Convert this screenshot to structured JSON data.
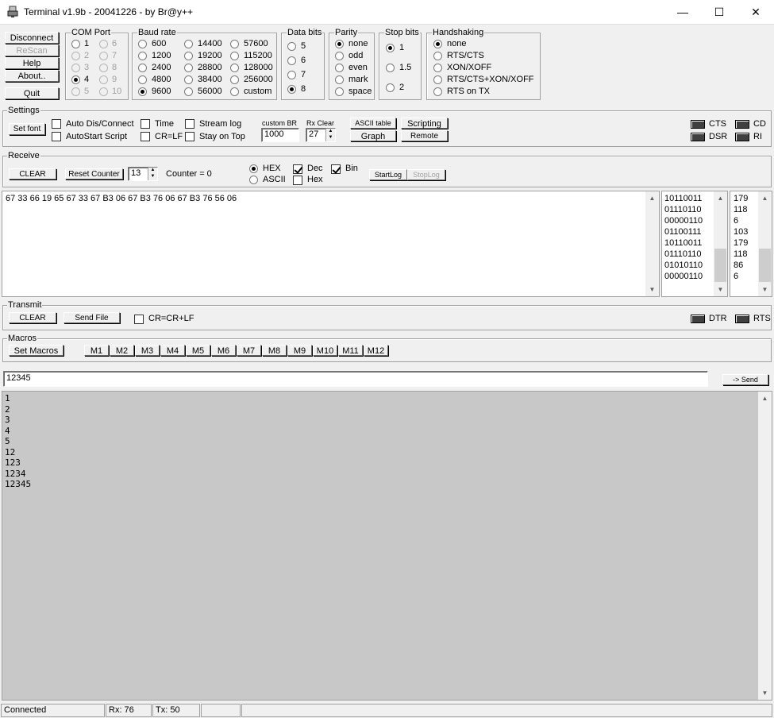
{
  "window": {
    "title": "Terminal v1.9b - 20041226 - by Br@y++",
    "minimize": "—",
    "maximize": "☐",
    "close": "✕"
  },
  "left_buttons": {
    "disconnect": "Disconnect",
    "rescan": "ReScan",
    "help": "Help",
    "about": "About..",
    "quit": "Quit"
  },
  "com_port": {
    "label": "COM Port",
    "options": [
      "1",
      "2",
      "3",
      "4",
      "5",
      "6",
      "7",
      "8",
      "9",
      "10"
    ],
    "selected": "4"
  },
  "baud_rate": {
    "label": "Baud rate",
    "options": [
      "600",
      "1200",
      "2400",
      "4800",
      "9600",
      "14400",
      "19200",
      "28800",
      "38400",
      "56000",
      "57600",
      "115200",
      "128000",
      "256000",
      "custom"
    ],
    "selected": "9600"
  },
  "data_bits": {
    "label": "Data bits",
    "options": [
      "5",
      "6",
      "7",
      "8"
    ],
    "selected": "8"
  },
  "parity": {
    "label": "Parity",
    "options": [
      "none",
      "odd",
      "even",
      "mark",
      "space"
    ],
    "selected": "none"
  },
  "stop_bits": {
    "label": "Stop bits",
    "options": [
      "1",
      "1.5",
      "2"
    ],
    "selected": "1"
  },
  "handshaking": {
    "label": "Handshaking",
    "options": [
      "none",
      "RTS/CTS",
      "XON/XOFF",
      "RTS/CTS+XON/XOFF",
      "RTS on TX"
    ],
    "selected": "none"
  },
  "settings": {
    "label": "Settings",
    "set_font": "Set font",
    "auto_dis_connect": "Auto Dis/Connect",
    "autostart_script": "AutoStart Script",
    "time": "Time",
    "cr_lf": "CR=LF",
    "stream_log": "Stream log",
    "stay_on_top": "Stay on Top",
    "custom_br_label": "custom BR",
    "custom_br_value": "1000",
    "rx_clear_label": "Rx Clear",
    "rx_clear_value": "27",
    "ascii_table": "ASCII table",
    "graph": "Graph",
    "scripting": "Scripting",
    "remote": "Remote",
    "cts": "CTS",
    "cd": "CD",
    "dsr": "DSR",
    "ri": "RI"
  },
  "receive": {
    "label": "Receive",
    "clear": "CLEAR",
    "reset_counter": "Reset Counter",
    "counter_spin": "13",
    "counter_label": "Counter =  0",
    "hex": "HEX",
    "ascii": "ASCII",
    "dec": "Dec",
    "hex_chk": "Hex",
    "bin": "Bin",
    "start_log": "StartLog",
    "stop_log": "StopLog",
    "data_text": "67 33 66 19 65 67 33 67 B3 06 67 B3 76 06 67 B3 76 56 06",
    "bin_values": [
      "10110011",
      "01110110",
      "00000110",
      "01100111",
      "10110011",
      "01110110",
      "01010110",
      "00000110"
    ],
    "dec_values": [
      "179",
      "118",
      "6",
      "103",
      "179",
      "118",
      "86",
      "6"
    ]
  },
  "transmit": {
    "label": "Transmit",
    "clear": "CLEAR",
    "send_file": "Send File",
    "cr_crlf": "CR=CR+LF",
    "dtr": "DTR",
    "rts": "RTS"
  },
  "macros": {
    "label": "Macros",
    "set_macros": "Set Macros",
    "buttons": [
      "M1",
      "M2",
      "M3",
      "M4",
      "M5",
      "M6",
      "M7",
      "M8",
      "M9",
      "M10",
      "M11",
      "M12"
    ]
  },
  "send": {
    "input_value": "12345",
    "button": "-> Send"
  },
  "transmit_log": [
    "1",
    "2",
    "3",
    "4",
    "5",
    "12",
    "123",
    "1234",
    "12345"
  ],
  "status": {
    "connection": "Connected",
    "rx": "Rx: 76",
    "tx": "Tx: 50"
  }
}
